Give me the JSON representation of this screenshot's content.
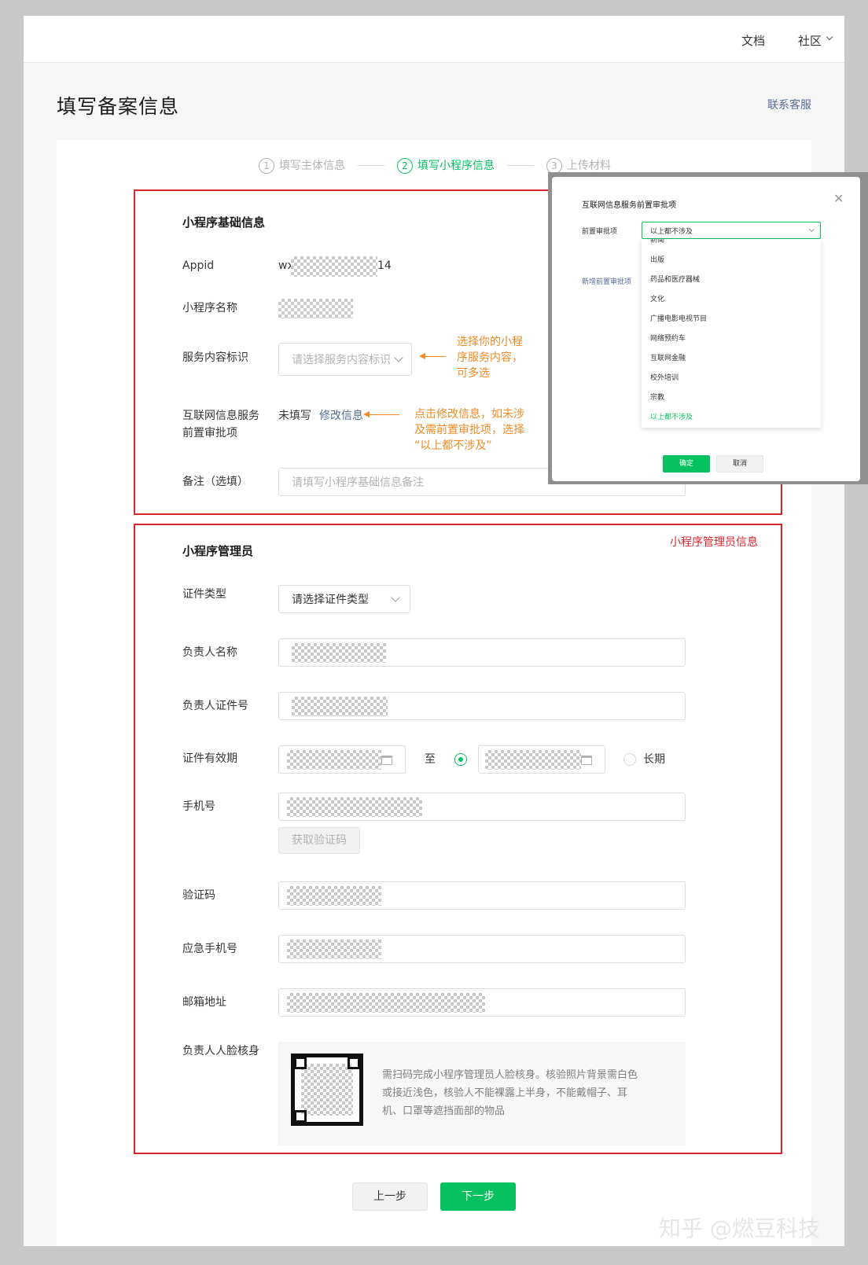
{
  "header": {
    "nav": [
      "文档",
      "社区"
    ]
  },
  "page": {
    "title": "填写备案信息",
    "contact": "联系客服"
  },
  "steps": [
    {
      "num": "1",
      "label": "填写主体信息"
    },
    {
      "num": "2",
      "label": "填写小程序信息"
    },
    {
      "num": "3",
      "label": "上传材料"
    }
  ],
  "basic": {
    "title": "小程序基础信息",
    "appid_label": "Appid",
    "appid_prefix": "wx",
    "appid_suffix": "14",
    "name_label": "小程序名称",
    "service_label": "服务内容标识",
    "service_placeholder": "请选择服务内容标识",
    "annot_service": [
      "选择你的小程",
      "序服务内容，",
      "可多选"
    ],
    "approval_label": [
      "互联网信息服务",
      "前置审批项"
    ],
    "approval_status": "未填写",
    "approval_link": "修改信息",
    "annot_approval": [
      "点击修改信息，如未涉",
      "及需前置审批项，选择",
      "“以上都不涉及”"
    ],
    "remark_label": "备注（选填）",
    "remark_placeholder": "请填写小程序基础信息备注"
  },
  "admin": {
    "title": "小程序管理员",
    "tag": "小程序管理员信息",
    "cert_type_label": "证件类型",
    "cert_type_value": "请选择证件类型",
    "name_label": "负责人名称",
    "id_label": "负责人证件号",
    "validity_label": "证件有效期",
    "to": "至",
    "long_term": "长期",
    "phone_label": "手机号",
    "get_code": "获取验证码",
    "code_label": "验证码",
    "emergency_label": "应急手机号",
    "email_label": "邮箱地址",
    "face_label": "负责人人脸核身",
    "face_desc": [
      "需扫码完成小程序管理员人脸核身。核验照片背景需白色",
      "或接近浅色，核验人不能裸露上半身，不能戴帽子、耳",
      "机、口罩等遮挡面部的物品"
    ]
  },
  "footer": {
    "prev": "上一步",
    "next": "下一步"
  },
  "watermark": "知乎 @燃豆科技",
  "modal": {
    "title": "互联网信息服务前置审批项",
    "field_label": "前置审批项",
    "selected": "以上都不涉及",
    "add_link": "新增前置审批项",
    "partial_item": "新闻",
    "options": [
      "出版",
      "药品和医疗器械",
      "文化",
      "广播电影电视节目",
      "网络预约车",
      "互联网金融",
      "校外培训",
      "宗教",
      "以上都不涉及"
    ],
    "confirm": "确定",
    "cancel": "取消"
  },
  "colors": {
    "accent": "#07c160",
    "link": "#576b95",
    "annotation": "#f08a24",
    "highlight": "#d9262c"
  }
}
